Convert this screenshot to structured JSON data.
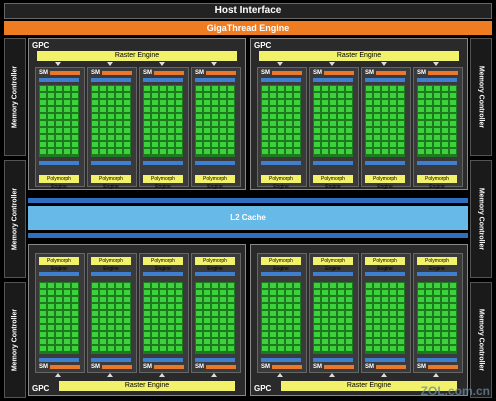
{
  "host_interface": "Host Interface",
  "gigathread": "GigaThread Engine",
  "memory_controller": "Memory Controller",
  "l2_cache": "L2 Cache",
  "gpc_label": "GPC",
  "raster_engine": "Raster Engine",
  "sm_label": "SM",
  "polymorph_engine": "Polymorph Engine",
  "watermark": "ZOL.com.cn"
}
